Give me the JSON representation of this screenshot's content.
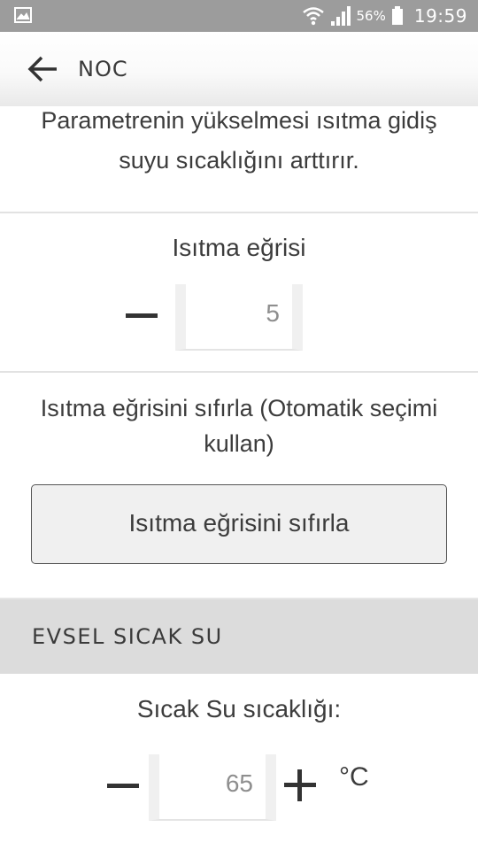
{
  "status_bar": {
    "battery_percent": "56%",
    "time": "19:59",
    "icons": [
      "gallery-icon",
      "wifi-icon",
      "signal-icon",
      "battery-icon"
    ]
  },
  "app_bar": {
    "title": "NOC",
    "back_icon": "arrow-left-icon"
  },
  "description": {
    "text": "Parametrenin yükselmesi ısıtma gidiş suyu sıcaklığını arttırır."
  },
  "heating_curve": {
    "label": "Isıtma eğrisi",
    "value": "5",
    "minus_icon": "minus-icon"
  },
  "reset_curve": {
    "description": "Isıtma eğrisini sıfırla (Otomatik seçimi kullan)",
    "button_label": "Isıtma eğrisini sıfırla"
  },
  "section_dhw": {
    "header": "EVSEL SICAK SU"
  },
  "hot_water": {
    "label": "Sıcak Su sıcaklığı:",
    "value": "65",
    "unit": "°C",
    "minus_icon": "minus-icon",
    "plus_icon": "plus-icon"
  },
  "colors": {
    "status_bar": "#9c9c9c",
    "section_header": "#dcdcdc",
    "text": "#3c3c3c",
    "button_bg": "#f0f0f0"
  }
}
